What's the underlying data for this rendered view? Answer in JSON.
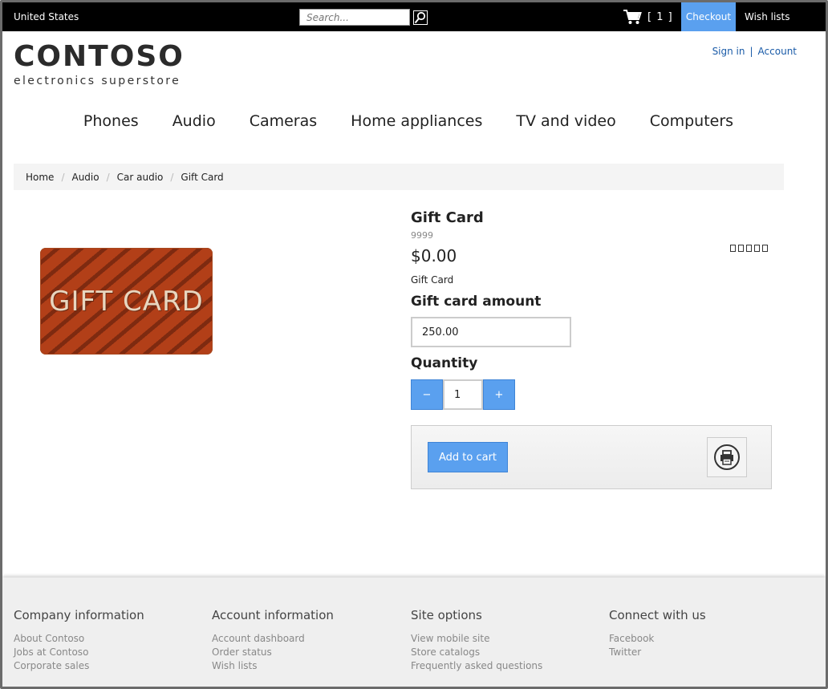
{
  "topbar": {
    "country": "United States",
    "search_placeholder": "Search...",
    "cart_count": "[ 1 ]",
    "checkout": "Checkout",
    "wish_lists": "Wish lists"
  },
  "logo": {
    "main": "CONTOSO",
    "tagline": "electronics superstore"
  },
  "account": {
    "sign_in": "Sign in",
    "separator": "|",
    "account": "Account"
  },
  "nav": [
    "Phones",
    "Audio",
    "Cameras",
    "Home appliances",
    "TV and video",
    "Computers"
  ],
  "breadcrumb": [
    "Home",
    "Audio",
    "Car audio",
    "Gift Card"
  ],
  "breadcrumb_divider": "/",
  "product": {
    "image_text": "GIFT CARD",
    "title": "Gift Card",
    "id": "9999",
    "price": "$0.00",
    "description": "Gift Card",
    "rating_stars": 5,
    "gift_card_amount_label": "Gift card amount",
    "gift_card_amount_value": "250.00",
    "quantity_label": "Quantity",
    "quantity_value": "1",
    "minus": "−",
    "plus": "+",
    "add_to_cart": "Add to cart"
  },
  "footer": {
    "columns": [
      {
        "title": "Company information",
        "links": [
          "About Contoso",
          "Jobs at Contoso",
          "Corporate sales"
        ]
      },
      {
        "title": "Account information",
        "links": [
          "Account dashboard",
          "Order status",
          "Wish lists"
        ]
      },
      {
        "title": "Site options",
        "links": [
          "View mobile site",
          "Store catalogs",
          "Frequently asked questions"
        ]
      },
      {
        "title": "Connect with us",
        "links": [
          "Facebook",
          "Twitter"
        ]
      }
    ]
  },
  "colors": {
    "accent": "#5aa0ef",
    "topbar": "#000000",
    "link": "#1a5ba8",
    "giftcard": "#b23f18"
  }
}
